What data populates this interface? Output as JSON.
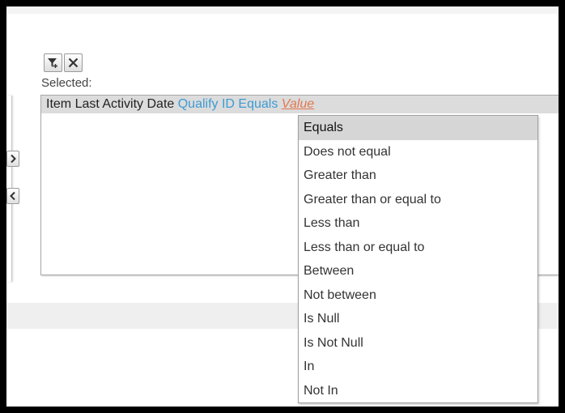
{
  "toolbar": {
    "add_filter_icon": "filter-plus-icon",
    "clear_icon": "close-icon"
  },
  "selected": {
    "label": "Selected:",
    "row": {
      "field": "Item Last Activity Date",
      "qualifier": "Qualify ID Equals",
      "value": "Value"
    }
  },
  "move_buttons": {
    "right_icon": "chevron-right-icon",
    "left_icon": "chevron-left-icon"
  },
  "operator_menu": {
    "selected": "Equals",
    "options": [
      "Equals",
      "Does not equal",
      "Greater than",
      "Greater than or equal to",
      "Less than",
      "Less than or equal to",
      "Between",
      "Not between",
      "Is Null",
      "Is Not Null",
      "In",
      "Not In"
    ]
  },
  "colors": {
    "qualifier": "#3d9bd3",
    "value_link": "#e0784f",
    "selected_row": "#dcdcdc"
  }
}
